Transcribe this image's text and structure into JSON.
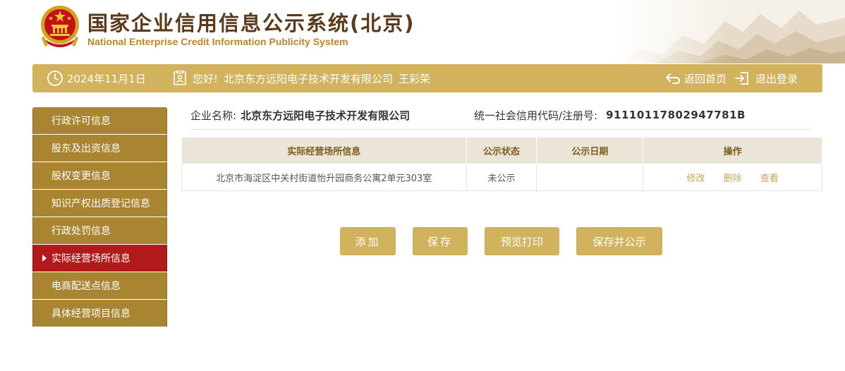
{
  "header": {
    "title": "国家企业信用信息公示系统(北京)",
    "subtitle": "National Enterprise Credit Information Publicity System"
  },
  "infobar": {
    "date": "2024年11月1日",
    "greeting": "您好!",
    "company": "北京东方远阳电子技术开发有限公司",
    "user": "王彩荣",
    "home_label": "返回首页",
    "logout_label": "退出登录"
  },
  "sidebar": {
    "items": [
      {
        "label": "行政许可信息"
      },
      {
        "label": "股东及出资信息"
      },
      {
        "label": "股权变更信息"
      },
      {
        "label": "知识产权出质登记信息"
      },
      {
        "label": "行政处罚信息"
      },
      {
        "label": "实际经营场所信息",
        "active": true
      },
      {
        "label": "电商配送点信息"
      },
      {
        "label": "具体经营项目信息"
      }
    ]
  },
  "main": {
    "company_label": "企业名称:",
    "company_name": "北京东方远阳电子技术开发有限公司",
    "credit_label": "统一社会信用代码/注册号:",
    "credit_code": "91110117802947781B",
    "table": {
      "headers": [
        "实际经营场所信息",
        "公示状态",
        "公示日期",
        "操作"
      ],
      "rows": [
        {
          "address": "北京市海淀区中关村街道怡升园商务公寓2单元303室",
          "status": "未公示",
          "date": "",
          "actions": [
            "修改",
            "删除",
            "查看"
          ]
        }
      ]
    },
    "buttons": {
      "add": "添加",
      "save": "保存",
      "preview": "预览打印",
      "save_publish": "保存并公示"
    }
  },
  "colors": {
    "gold": "#d3b25e",
    "sidebar_bg": "#a98431",
    "active_red": "#b1191a",
    "title_brown": "#5a3a1a",
    "subtitle_gold": "#b8862c"
  }
}
